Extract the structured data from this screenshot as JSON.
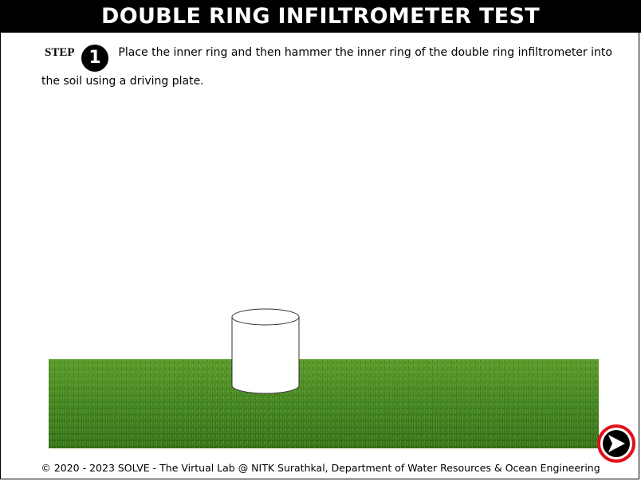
{
  "header": {
    "title": "DOUBLE RING INFILTROMETER TEST"
  },
  "step": {
    "label": "STEP",
    "number": "1",
    "instruction": "Place the inner ring and then hammer the inner ring of the double ring infiltrometer into the soil using a driving plate."
  },
  "footer": {
    "text": "© 2020 - 2023 SOLVE - The Virtual Lab @ NITK Surathkal, Department of Water Resources & Ocean Engineering"
  },
  "next_button": {
    "icon": "next-arrow-icon",
    "ring_color": "#e0101a"
  },
  "colors": {
    "grass_dark": "#2f6d14",
    "grass_mid": "#4a8f22",
    "grass_light": "#74b53a"
  }
}
